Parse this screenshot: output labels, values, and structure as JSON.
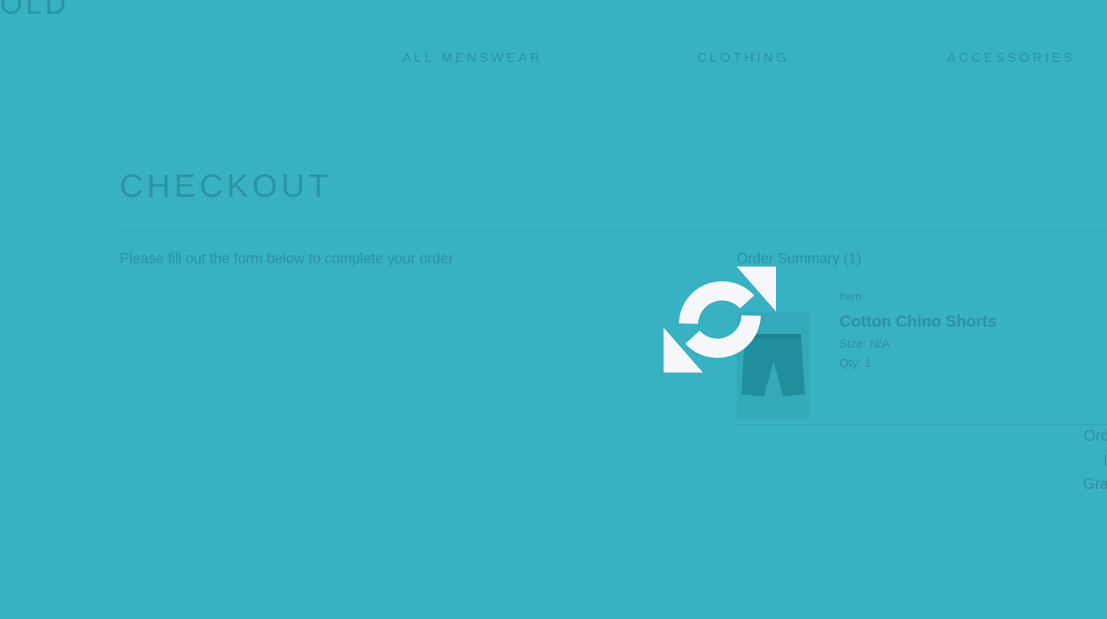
{
  "header": {
    "brand": "OLD",
    "nav": [
      "ALL MENSWEAR",
      "CLOTHING",
      "ACCESSORIES"
    ]
  },
  "checkout": {
    "title": "CHECKOUT",
    "instructions": "Please fill out the form below to complete your order"
  },
  "order_summary": {
    "title": "Order Summary (1)",
    "item_header": "Item",
    "item": {
      "name": "Cotton Chino Shorts",
      "size": "Size: N/A",
      "qty": "Qty: 1"
    },
    "totals_partial": [
      "Ord",
      "l",
      "Gra"
    ]
  },
  "overlay": {
    "icon": "refresh-icon"
  },
  "colors": {
    "background": "#38b1c3",
    "text": "#2a93a5",
    "spinner": "#f5f7fa"
  }
}
